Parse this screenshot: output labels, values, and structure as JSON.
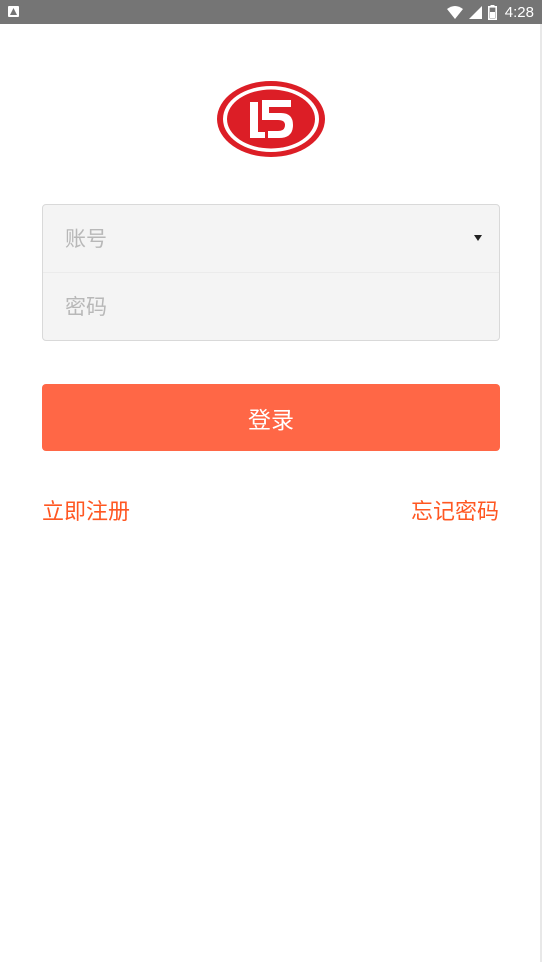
{
  "status_bar": {
    "time": "4:28",
    "icons": [
      "notification-icon",
      "wifi-icon",
      "signal-icon",
      "battery-icon"
    ]
  },
  "logo": {
    "icon": "brand-logo",
    "colors": {
      "primary": "#dc1e26",
      "secondary": "#ffffff"
    }
  },
  "login_form": {
    "account": {
      "placeholder": "账号",
      "value": "",
      "icon": "dropdown-arrow-icon"
    },
    "password": {
      "placeholder": "密码",
      "value": ""
    }
  },
  "login_button": {
    "label": "登录",
    "color": "#ff6746"
  },
  "links": {
    "register": "立即注册",
    "forgot_password": "忘记密码",
    "color": "#ff5722"
  }
}
